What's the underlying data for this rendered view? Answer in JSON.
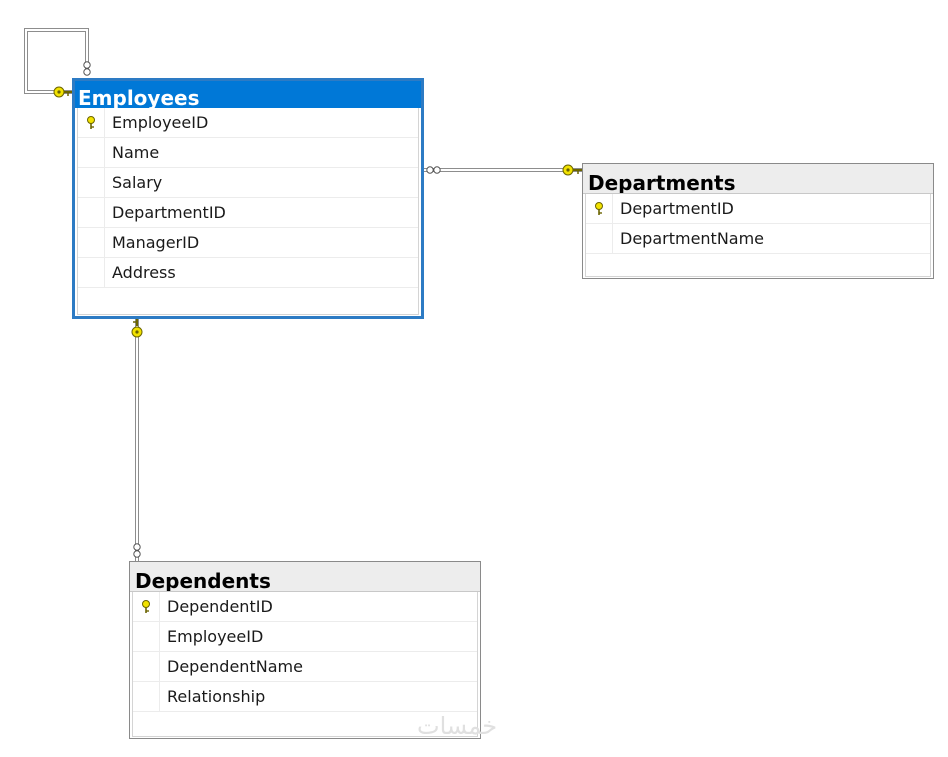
{
  "tables": {
    "employees": {
      "title": "Employees",
      "columns": [
        {
          "name": "EmployeeID",
          "primary_key": true
        },
        {
          "name": "Name",
          "primary_key": false
        },
        {
          "name": "Salary",
          "primary_key": false
        },
        {
          "name": "DepartmentID",
          "primary_key": false
        },
        {
          "name": "ManagerID",
          "primary_key": false
        },
        {
          "name": "Address",
          "primary_key": false
        }
      ]
    },
    "departments": {
      "title": "Departments",
      "columns": [
        {
          "name": "DepartmentID",
          "primary_key": true
        },
        {
          "name": "DepartmentName",
          "primary_key": false
        }
      ]
    },
    "dependents": {
      "title": "Dependents",
      "columns": [
        {
          "name": "DependentID",
          "primary_key": true
        },
        {
          "name": "EmployeeID",
          "primary_key": false
        },
        {
          "name": "DependentName",
          "primary_key": false
        },
        {
          "name": "Relationship",
          "primary_key": false
        }
      ]
    }
  },
  "relationships": [
    {
      "name": "Employees-self",
      "one_end": "key",
      "many_end": "infinity"
    },
    {
      "name": "Departments-Employees",
      "one_end": "key",
      "many_end": "infinity"
    },
    {
      "name": "Employees-Dependents",
      "one_end": "key",
      "many_end": "infinity"
    }
  ],
  "watermark": "خمسات",
  "colors": {
    "selected_header": "#0078d7",
    "selected_border": "#2d7bc4",
    "header": "#ededed",
    "key_icon": "#f2e200"
  }
}
